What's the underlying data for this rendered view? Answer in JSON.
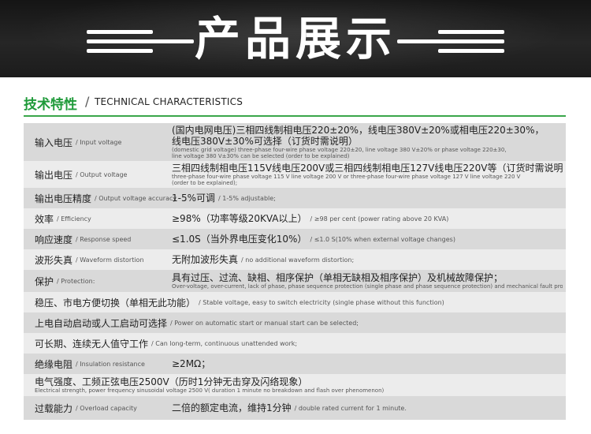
{
  "header": {
    "title": "产品展示"
  },
  "section": {
    "title_zh": "技术特性",
    "slash": "/",
    "title_en": "TECHNICAL CHARACTERISTICS"
  },
  "rows": [
    {
      "label_zh": "输入电压",
      "label_en": "/ Input voltage",
      "value_lines": [
        "(国内电网电压)三相四线制相电压220±20%，线电压380V±20%或相电压220±30%，",
        "线电压380V±30%可选择（订货时需说明）"
      ],
      "value_sub": [
        "(domestic grid voltage) three-phase four-wire phase voltage 220±20, line voltage 380 V±20% or phase voltage 220±30,",
        "line voltage 380 V±30% can be selected (order to be explained)"
      ]
    },
    {
      "label_zh": "输出电压",
      "label_en": "/ Output voltage",
      "value_lines": [
        "三相四线制相电压115V线电压200V或三相四线制相电压127V线电压220V等（订货时需说明）；"
      ],
      "value_sub": [
        "three-phase four-wire phase voltage 115 V line voltage 200 V or three-phase four-wire phase voltage 127 V line voltage 220 V",
        "(order to be explained);"
      ]
    },
    {
      "label_zh": "输出电压精度",
      "label_en": "/ Output voltage accuracy",
      "value_zh": "1-5%可调",
      "value_en": "/ 1-5% adjustable;"
    },
    {
      "label_zh": "效率",
      "label_en": "/ Efficiency",
      "value_zh": "≥98%（功率等级20KVA以上）",
      "value_en": "/ ≥98 per cent (power rating above 20 KVA)"
    },
    {
      "label_zh": "响应速度",
      "label_en": "/ Response speed",
      "value_zh": "≤1.0S（当外界电压变化10%）",
      "value_en": "/ ≤1.0 S(10% when external voltage changes)"
    },
    {
      "label_zh": "波形失真",
      "label_en": "/ Waveform distortion",
      "value_zh": "无附加波形失真",
      "value_en": "/ no additional waveform distortion;"
    },
    {
      "label_zh": "保护",
      "label_en": "/ Protection:",
      "value_lines": [
        "具有过压、过流、缺相、相序保护（单相无缺相及相序保护）及机械故障保护；"
      ],
      "value_sub": [
        "Over-voltage, over-current, lack of phase, phase sequence protection (single phase and phase sequence protection) and mechanical fault protection;"
      ]
    },
    {
      "label_zh": "稳压、市电方便切换（单相无此功能）",
      "label_en": "/ Stable voltage, easy to switch electricity (single phase without this function)"
    },
    {
      "label_zh": "上电自动启动或人工启动可选择",
      "label_en": "/ Power on automatic start or manual start can be selected;"
    },
    {
      "label_zh": "可长期、连续无人值守工作",
      "label_en": "/ Can long-term, continuous unattended work;"
    },
    {
      "label_zh": "绝缘电阻",
      "label_en": "/ Insulation resistance",
      "value_zh": "≥2MΩ；"
    },
    {
      "label_zh": "电气强度、工频正弦电压2500V（历时1分钟无击穿及闪络现象）",
      "label_sub": "Electrical strength, power frequency sinusoidal voltage 2500 V( duration 1 minute no breakdown and flash over phenomenon)"
    },
    {
      "label_zh": "过载能力",
      "label_en": "/ Overload capacity",
      "value_zh": "二倍的额定电流，维持1分钟",
      "value_en": "/ double rated current for 1 minute."
    }
  ]
}
